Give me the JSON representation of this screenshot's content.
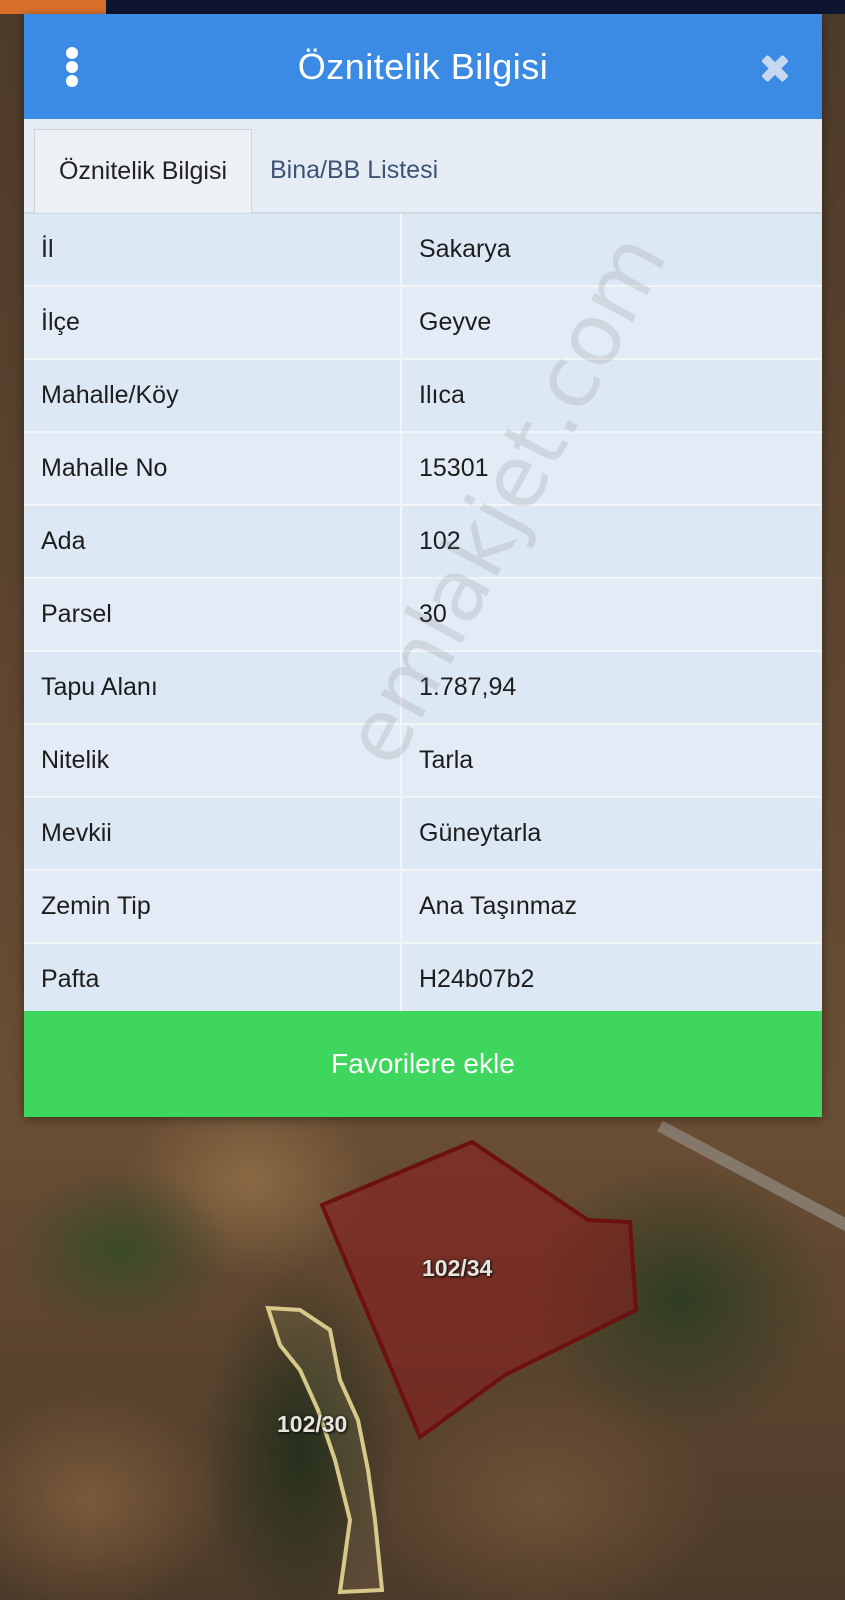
{
  "dialog": {
    "title": "Öznitelik Bilgisi",
    "close_icon": "close-icon",
    "menu_icon": "vertical-dots-icon"
  },
  "tabs": [
    {
      "label": "Öznitelik Bilgisi",
      "active": true
    },
    {
      "label": "Bina/BB Listesi",
      "active": false
    }
  ],
  "attributes": [
    {
      "key": "İl",
      "value": "Sakarya"
    },
    {
      "key": "İlçe",
      "value": "Geyve"
    },
    {
      "key": "Mahalle/Köy",
      "value": "Ilıca"
    },
    {
      "key": "Mahalle No",
      "value": "15301"
    },
    {
      "key": "Ada",
      "value": "102"
    },
    {
      "key": "Parsel",
      "value": "30"
    },
    {
      "key": "Tapu Alanı",
      "value": "1.787,94"
    },
    {
      "key": "Nitelik",
      "value": "Tarla"
    },
    {
      "key": "Mevkii",
      "value": "Güneytarla"
    },
    {
      "key": "Zemin Tip",
      "value": "Ana Taşınmaz"
    },
    {
      "key": "Pafta",
      "value": "H24b07b2"
    }
  ],
  "favorite_button": "Favorilere ekle",
  "watermark": "emlakjet.com",
  "map": {
    "parcels": [
      {
        "label": "102/34",
        "color": "#8b1c1c"
      },
      {
        "label": "102/30",
        "color": "#d8c98a"
      }
    ]
  },
  "colors": {
    "header": "#3b8be4",
    "favorite_button": "#3fd65e",
    "table_row": "#dde8f5"
  }
}
